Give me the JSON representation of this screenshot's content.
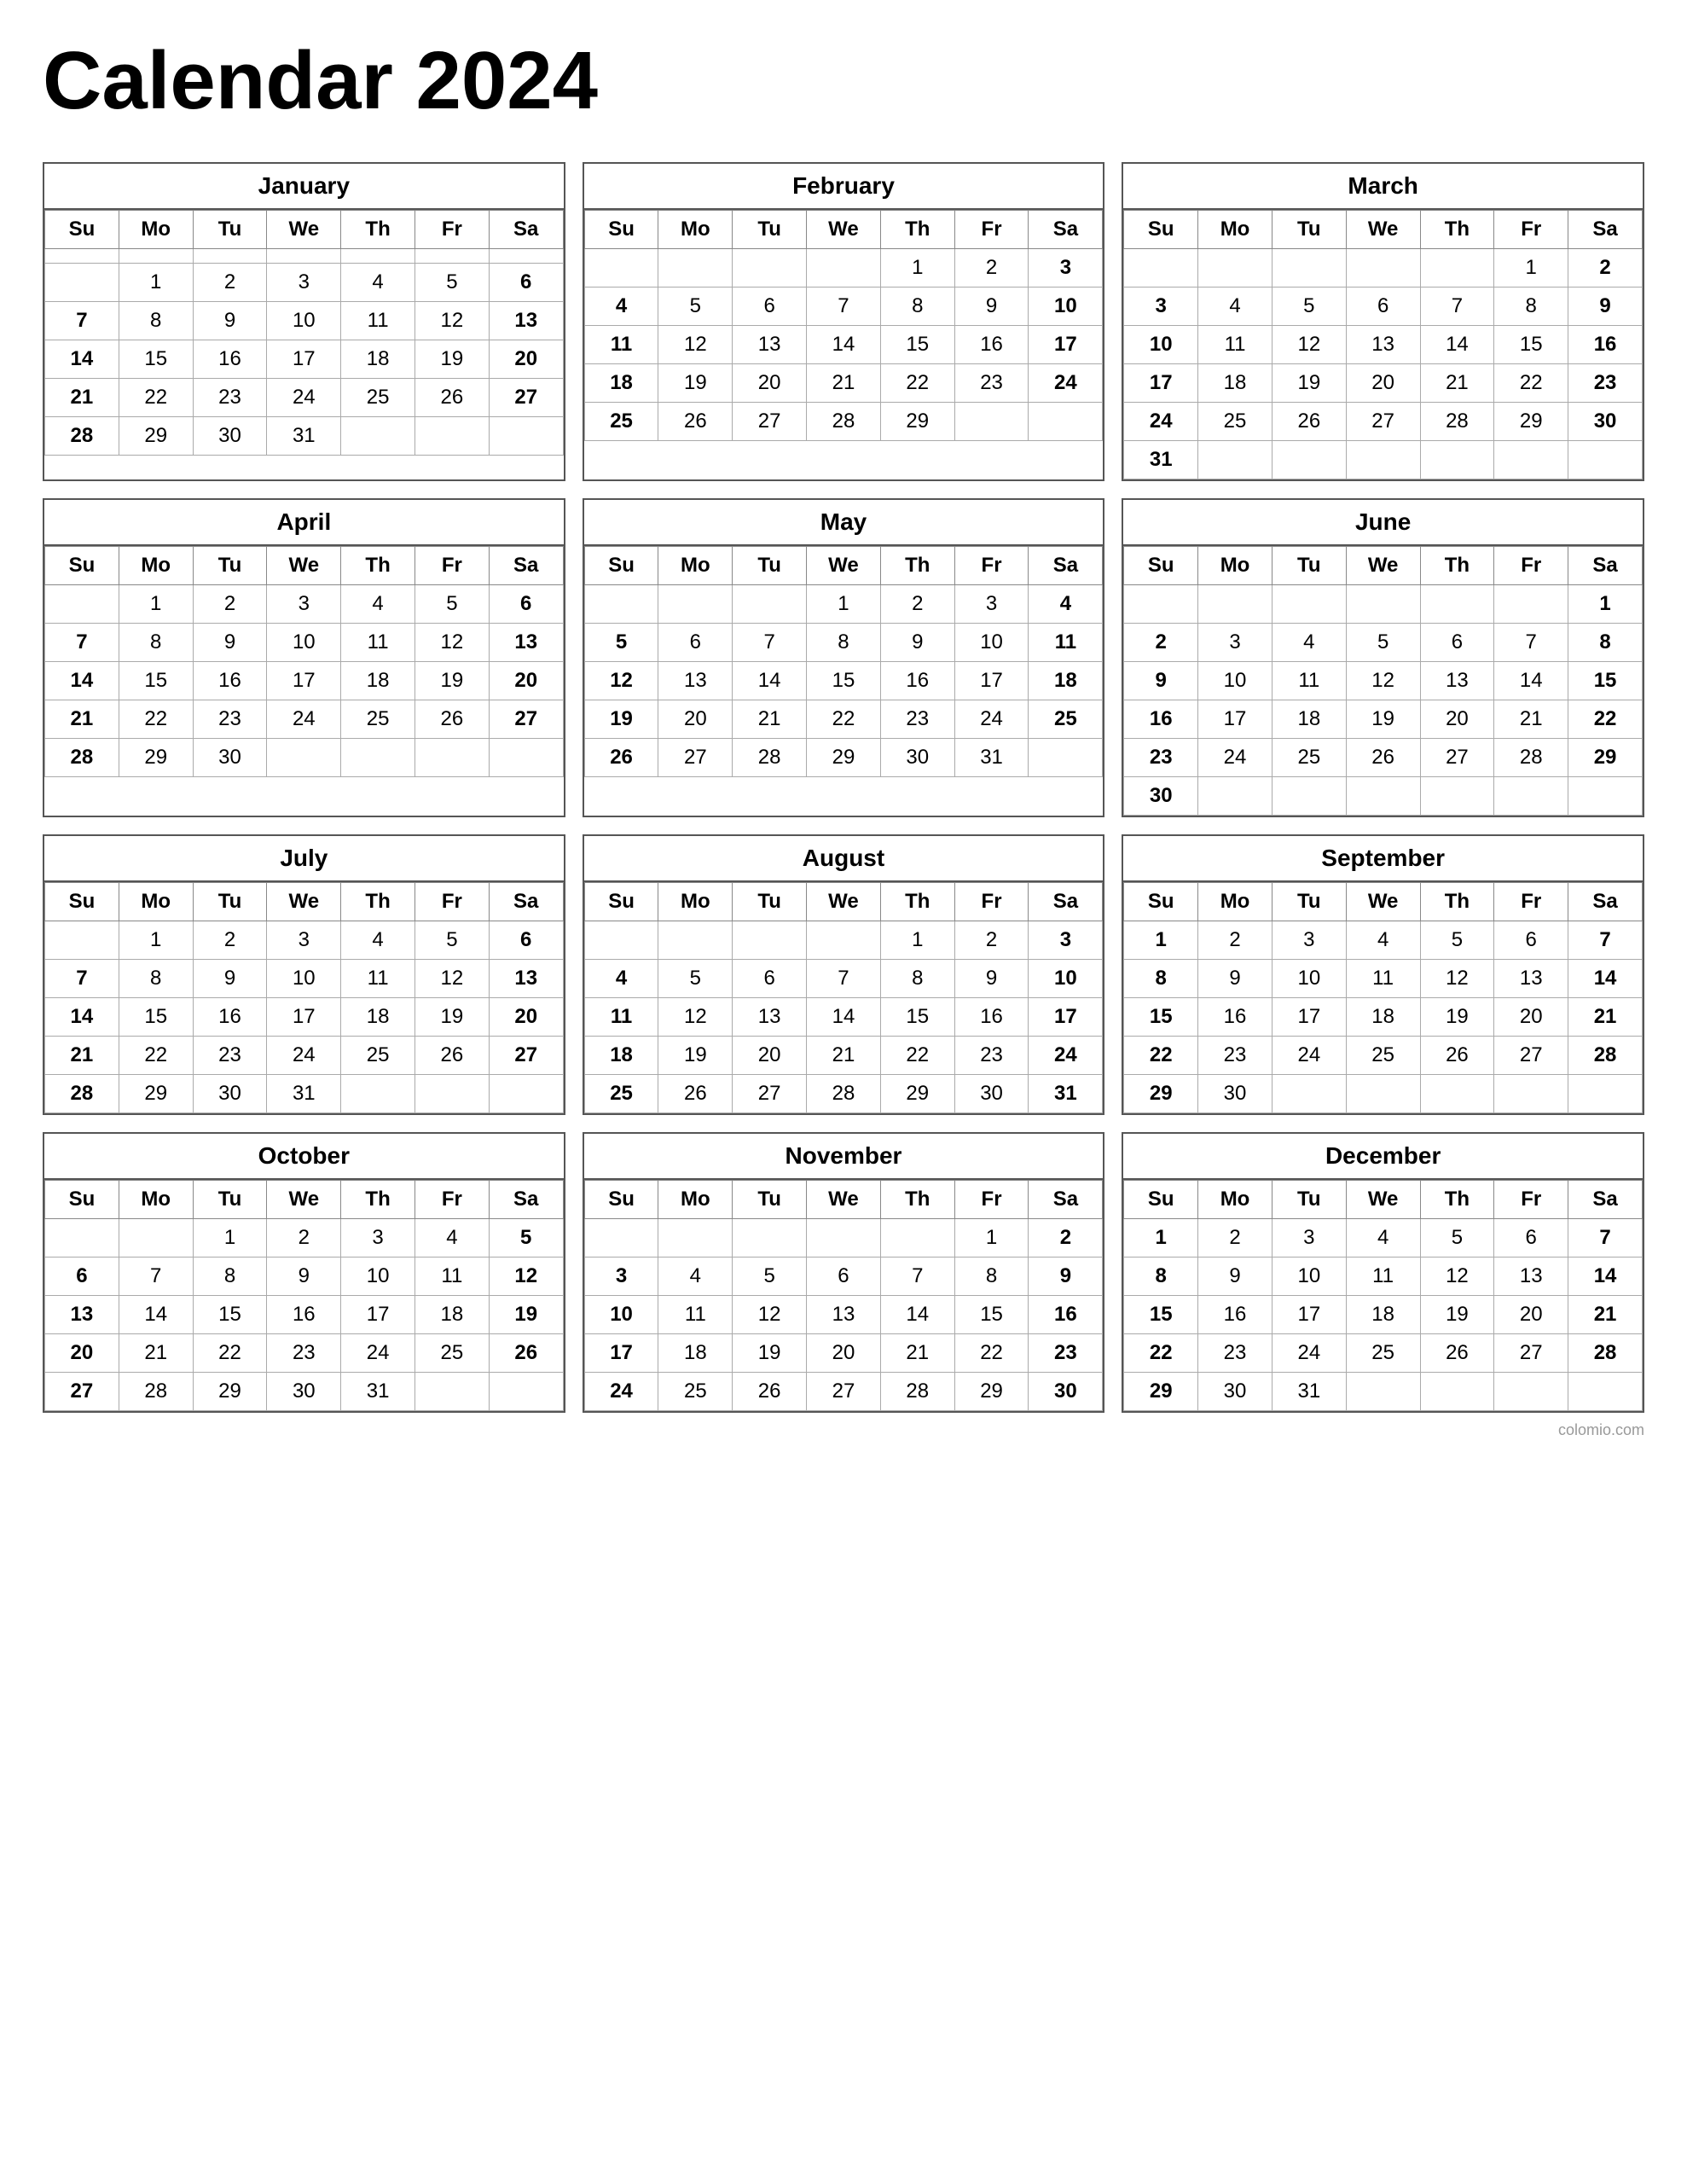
{
  "title": "Calendar 2024",
  "watermark": "colomio.com",
  "months": [
    {
      "name": "January",
      "days": [
        [
          "",
          "",
          "",
          "",
          "",
          "",
          ""
        ],
        [
          "",
          "1",
          "2",
          "3",
          "4",
          "5",
          "6"
        ],
        [
          "7",
          "8",
          "9",
          "10",
          "11",
          "12",
          "13"
        ],
        [
          "14",
          "15",
          "16",
          "17",
          "18",
          "19",
          "20"
        ],
        [
          "21",
          "22",
          "23",
          "24",
          "25",
          "26",
          "27"
        ],
        [
          "28",
          "29",
          "30",
          "31",
          "",
          "",
          ""
        ]
      ]
    },
    {
      "name": "February",
      "days": [
        [
          "",
          "",
          "",
          "",
          "1",
          "2",
          "3"
        ],
        [
          "4",
          "5",
          "6",
          "7",
          "8",
          "9",
          "10"
        ],
        [
          "11",
          "12",
          "13",
          "14",
          "15",
          "16",
          "17"
        ],
        [
          "18",
          "19",
          "20",
          "21",
          "22",
          "23",
          "24"
        ],
        [
          "25",
          "26",
          "27",
          "28",
          "29",
          "",
          ""
        ]
      ]
    },
    {
      "name": "March",
      "days": [
        [
          "",
          "",
          "",
          "",
          "",
          "1",
          "2"
        ],
        [
          "3",
          "4",
          "5",
          "6",
          "7",
          "8",
          "9"
        ],
        [
          "10",
          "11",
          "12",
          "13",
          "14",
          "15",
          "16"
        ],
        [
          "17",
          "18",
          "19",
          "20",
          "21",
          "22",
          "23"
        ],
        [
          "24",
          "25",
          "26",
          "27",
          "28",
          "29",
          "30"
        ],
        [
          "31",
          "",
          "",
          "",
          "",
          "",
          ""
        ]
      ]
    },
    {
      "name": "April",
      "days": [
        [
          "",
          "1",
          "2",
          "3",
          "4",
          "5",
          "6"
        ],
        [
          "7",
          "8",
          "9",
          "10",
          "11",
          "12",
          "13"
        ],
        [
          "14",
          "15",
          "16",
          "17",
          "18",
          "19",
          "20"
        ],
        [
          "21",
          "22",
          "23",
          "24",
          "25",
          "26",
          "27"
        ],
        [
          "28",
          "29",
          "30",
          "",
          "",
          "",
          ""
        ]
      ]
    },
    {
      "name": "May",
      "days": [
        [
          "",
          "",
          "",
          "1",
          "2",
          "3",
          "4"
        ],
        [
          "5",
          "6",
          "7",
          "8",
          "9",
          "10",
          "11"
        ],
        [
          "12",
          "13",
          "14",
          "15",
          "16",
          "17",
          "18"
        ],
        [
          "19",
          "20",
          "21",
          "22",
          "23",
          "24",
          "25"
        ],
        [
          "26",
          "27",
          "28",
          "29",
          "30",
          "31",
          ""
        ]
      ]
    },
    {
      "name": "June",
      "days": [
        [
          "",
          "",
          "",
          "",
          "",
          "",
          "1"
        ],
        [
          "2",
          "3",
          "4",
          "5",
          "6",
          "7",
          "8"
        ],
        [
          "9",
          "10",
          "11",
          "12",
          "13",
          "14",
          "15"
        ],
        [
          "16",
          "17",
          "18",
          "19",
          "20",
          "21",
          "22"
        ],
        [
          "23",
          "24",
          "25",
          "26",
          "27",
          "28",
          "29"
        ],
        [
          "30",
          "",
          "",
          "",
          "",
          "",
          ""
        ]
      ]
    },
    {
      "name": "July",
      "days": [
        [
          "",
          "1",
          "2",
          "3",
          "4",
          "5",
          "6"
        ],
        [
          "7",
          "8",
          "9",
          "10",
          "11",
          "12",
          "13"
        ],
        [
          "14",
          "15",
          "16",
          "17",
          "18",
          "19",
          "20"
        ],
        [
          "21",
          "22",
          "23",
          "24",
          "25",
          "26",
          "27"
        ],
        [
          "28",
          "29",
          "30",
          "31",
          "",
          "",
          ""
        ]
      ]
    },
    {
      "name": "August",
      "days": [
        [
          "",
          "",
          "",
          "",
          "1",
          "2",
          "3"
        ],
        [
          "4",
          "5",
          "6",
          "7",
          "8",
          "9",
          "10"
        ],
        [
          "11",
          "12",
          "13",
          "14",
          "15",
          "16",
          "17"
        ],
        [
          "18",
          "19",
          "20",
          "21",
          "22",
          "23",
          "24"
        ],
        [
          "25",
          "26",
          "27",
          "28",
          "29",
          "30",
          "31"
        ]
      ]
    },
    {
      "name": "September",
      "days": [
        [
          "1",
          "2",
          "3",
          "4",
          "5",
          "6",
          "7"
        ],
        [
          "8",
          "9",
          "10",
          "11",
          "12",
          "13",
          "14"
        ],
        [
          "15",
          "16",
          "17",
          "18",
          "19",
          "20",
          "21"
        ],
        [
          "22",
          "23",
          "24",
          "25",
          "26",
          "27",
          "28"
        ],
        [
          "29",
          "30",
          "",
          "",
          "",
          "",
          ""
        ]
      ]
    },
    {
      "name": "October",
      "days": [
        [
          "",
          "",
          "1",
          "2",
          "3",
          "4",
          "5"
        ],
        [
          "6",
          "7",
          "8",
          "9",
          "10",
          "11",
          "12"
        ],
        [
          "13",
          "14",
          "15",
          "16",
          "17",
          "18",
          "19"
        ],
        [
          "20",
          "21",
          "22",
          "23",
          "24",
          "25",
          "26"
        ],
        [
          "27",
          "28",
          "29",
          "30",
          "31",
          "",
          ""
        ]
      ]
    },
    {
      "name": "November",
      "days": [
        [
          "",
          "",
          "",
          "",
          "",
          "1",
          "2"
        ],
        [
          "3",
          "4",
          "5",
          "6",
          "7",
          "8",
          "9"
        ],
        [
          "10",
          "11",
          "12",
          "13",
          "14",
          "15",
          "16"
        ],
        [
          "17",
          "18",
          "19",
          "20",
          "21",
          "22",
          "23"
        ],
        [
          "24",
          "25",
          "26",
          "27",
          "28",
          "29",
          "30"
        ]
      ]
    },
    {
      "name": "December",
      "days": [
        [
          "1",
          "2",
          "3",
          "4",
          "5",
          "6",
          "7"
        ],
        [
          "8",
          "9",
          "10",
          "11",
          "12",
          "13",
          "14"
        ],
        [
          "15",
          "16",
          "17",
          "18",
          "19",
          "20",
          "21"
        ],
        [
          "22",
          "23",
          "24",
          "25",
          "26",
          "27",
          "28"
        ],
        [
          "29",
          "30",
          "31",
          "",
          "",
          "",
          ""
        ]
      ]
    }
  ],
  "weekdays": [
    "Su",
    "Mo",
    "Tu",
    "We",
    "Th",
    "Fr",
    "Sa"
  ]
}
